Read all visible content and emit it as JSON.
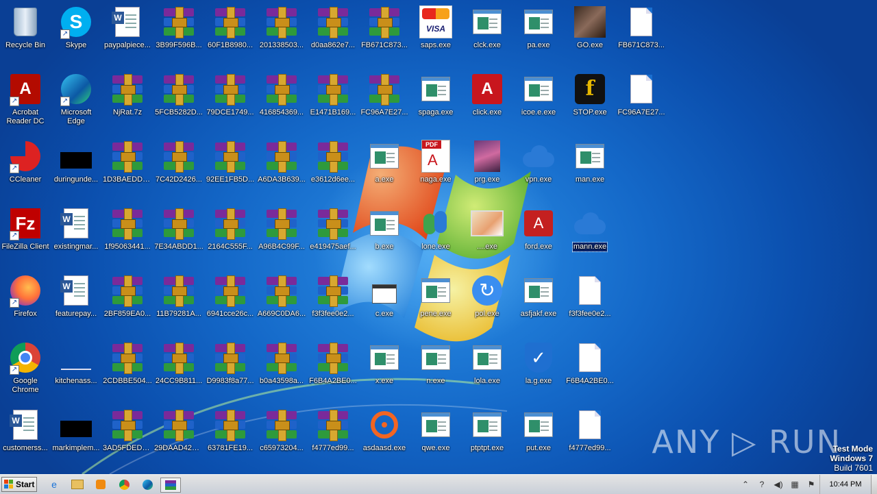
{
  "desktop": {
    "icons": [
      {
        "id": "recycle",
        "label": "Recycle Bin",
        "type": "recycle"
      },
      {
        "id": "skype",
        "label": "Skype",
        "type": "skype"
      },
      {
        "id": "paypal",
        "label": "paypalpiece...",
        "type": "word"
      },
      {
        "id": "a1",
        "label": "3B99F596B...",
        "type": "archive"
      },
      {
        "id": "a2",
        "label": "60F1B8980...",
        "type": "archive"
      },
      {
        "id": "a3",
        "label": "201338503...",
        "type": "archive"
      },
      {
        "id": "a4",
        "label": "d0aa862e7...",
        "type": "archive"
      },
      {
        "id": "a5",
        "label": "FB671C873...",
        "type": "archive"
      },
      {
        "id": "saps",
        "label": "saps.exe",
        "type": "card"
      },
      {
        "id": "clck",
        "label": "clck.exe",
        "type": "exe"
      },
      {
        "id": "pa",
        "label": "pa.exe",
        "type": "exe"
      },
      {
        "id": "go",
        "label": "GO.exe",
        "type": "photo"
      },
      {
        "id": "fb1",
        "label": "FB671C873...",
        "type": "blank"
      },
      {
        "id": "acrobat",
        "label": "Acrobat Reader DC",
        "type": "acrobat"
      },
      {
        "id": "edge",
        "label": "Microsoft Edge",
        "type": "edge"
      },
      {
        "id": "njrat",
        "label": "NjRat.7z",
        "type": "archive"
      },
      {
        "id": "b1",
        "label": "5FCB5282D...",
        "type": "archive"
      },
      {
        "id": "b2",
        "label": "79DCE1749...",
        "type": "archive"
      },
      {
        "id": "b3",
        "label": "416854369...",
        "type": "archive"
      },
      {
        "id": "b4",
        "label": "E1471B169...",
        "type": "archive"
      },
      {
        "id": "b5",
        "label": "FC96A7E27...",
        "type": "archive"
      },
      {
        "id": "spaga",
        "label": "spaga.exe",
        "type": "exe"
      },
      {
        "id": "click",
        "label": "click.exe",
        "type": "pdf"
      },
      {
        "id": "icoe",
        "label": "icoe.e.exe",
        "type": "exe"
      },
      {
        "id": "stop",
        "label": "STOP.exe",
        "type": "fb"
      },
      {
        "id": "fc1",
        "label": "FC96A7E27...",
        "type": "blank"
      },
      {
        "id": "ccleaner",
        "label": "CCleaner",
        "type": "ccleaner"
      },
      {
        "id": "during",
        "label": "duringunde...",
        "type": "black"
      },
      {
        "id": "c1",
        "label": "1D3BAEDD7...",
        "type": "archive"
      },
      {
        "id": "c2",
        "label": "7C42D2426...",
        "type": "archive"
      },
      {
        "id": "c3",
        "label": "92EE1FB5D...",
        "type": "archive"
      },
      {
        "id": "c4",
        "label": "A6DA3B639...",
        "type": "archive"
      },
      {
        "id": "c5",
        "label": "e3612d6ee...",
        "type": "archive"
      },
      {
        "id": "aexe",
        "label": "a.exe",
        "type": "exe"
      },
      {
        "id": "naga",
        "label": "naga.exe",
        "type": "pdfdoc"
      },
      {
        "id": "prg",
        "label": "prg.exe",
        "type": "photo2"
      },
      {
        "id": "vpn",
        "label": "vpn.exe",
        "type": "cloud"
      },
      {
        "id": "man",
        "label": "man.exe",
        "type": "exe"
      },
      {
        "id": "filezilla",
        "label": "FileZilla Client",
        "type": "filezilla"
      },
      {
        "id": "existing",
        "label": "existingmar...",
        "type": "word"
      },
      {
        "id": "d1",
        "label": "1f95063441...",
        "type": "archive"
      },
      {
        "id": "d2",
        "label": "7E34ABDD1...",
        "type": "archive"
      },
      {
        "id": "d3",
        "label": "2164C555F...",
        "type": "archive"
      },
      {
        "id": "d4",
        "label": "A96B4C99F...",
        "type": "archive"
      },
      {
        "id": "d5",
        "label": "e419475aef...",
        "type": "archive"
      },
      {
        "id": "bexe",
        "label": "b.exe",
        "type": "exe"
      },
      {
        "id": "lone",
        "label": "lone.exe",
        "type": "msn"
      },
      {
        "id": "img1",
        "label": "....exe",
        "type": "imgfile"
      },
      {
        "id": "ford",
        "label": "ford.exe",
        "type": "redbox"
      },
      {
        "id": "mann",
        "label": "mann.exe",
        "type": "cloud",
        "selected": true
      },
      {
        "id": "firefox",
        "label": "Firefox",
        "type": "firefox"
      },
      {
        "id": "featurepay",
        "label": "featurepay...",
        "type": "word"
      },
      {
        "id": "e1",
        "label": "2BF859EA0...",
        "type": "archive"
      },
      {
        "id": "e2",
        "label": "11B79281A...",
        "type": "archive"
      },
      {
        "id": "e3",
        "label": "6941cce26c...",
        "type": "archive"
      },
      {
        "id": "e4",
        "label": "A669C0DA6...",
        "type": "archive"
      },
      {
        "id": "e5",
        "label": "f3f3fee0e2...",
        "type": "archive"
      },
      {
        "id": "cexe",
        "label": "c.exe",
        "type": "folderwin"
      },
      {
        "id": "pene",
        "label": "pene.exe",
        "type": "exe"
      },
      {
        "id": "pol",
        "label": "pol.exe",
        "type": "gear"
      },
      {
        "id": "asf",
        "label": "asfjakf.exe",
        "type": "exe"
      },
      {
        "id": "f3b",
        "label": "f3f3fee0e2...",
        "type": "blank"
      },
      {
        "id": "chrome",
        "label": "Google Chrome",
        "type": "chrome"
      },
      {
        "id": "kitchen",
        "label": "kitchenass...",
        "type": "kitchen"
      },
      {
        "id": "f1",
        "label": "2CDBBE504...",
        "type": "archive"
      },
      {
        "id": "f2",
        "label": "24CC9B811...",
        "type": "archive"
      },
      {
        "id": "f3",
        "label": "D9983f8a77...",
        "type": "archive"
      },
      {
        "id": "f4",
        "label": "b0a43598a...",
        "type": "archive"
      },
      {
        "id": "f5",
        "label": "F6B4A2BE0...",
        "type": "archive"
      },
      {
        "id": "xexe",
        "label": "x.exe",
        "type": "exe"
      },
      {
        "id": "nexe",
        "label": "n.exe",
        "type": "exe"
      },
      {
        "id": "lola",
        "label": "lola.exe",
        "type": "exe"
      },
      {
        "id": "lag",
        "label": "la.g.exe",
        "type": "shield"
      },
      {
        "id": "f6b",
        "label": "F6B4A2BE0...",
        "type": "blank"
      },
      {
        "id": "customer",
        "label": "customerss...",
        "type": "word"
      },
      {
        "id": "markimp",
        "label": "markimplem...",
        "type": "black"
      },
      {
        "id": "g1",
        "label": "3AD5FDED9...",
        "type": "archive"
      },
      {
        "id": "g2",
        "label": "29DAAD42D...",
        "type": "archive"
      },
      {
        "id": "g3",
        "label": "63781FE19...",
        "type": "archive"
      },
      {
        "id": "g4",
        "label": "c65973204...",
        "type": "archive"
      },
      {
        "id": "g5",
        "label": "f4777ed99...",
        "type": "archive"
      },
      {
        "id": "asdaasd",
        "label": "asdaasd.exe",
        "type": "origin"
      },
      {
        "id": "qwe",
        "label": "qwe.exe",
        "type": "exe"
      },
      {
        "id": "ptptpt",
        "label": "ptptpt.exe",
        "type": "exe"
      },
      {
        "id": "put",
        "label": "put.exe",
        "type": "exe"
      },
      {
        "id": "f47b",
        "label": "f4777ed99...",
        "type": "blank"
      }
    ]
  },
  "watermark": {
    "text": "ANY ▷ RUN"
  },
  "testmode": {
    "line1": "Test Mode",
    "line2": "Windows 7",
    "line3": "Build 7601"
  },
  "taskbar": {
    "start_label": "Start",
    "clock": "10:44 PM",
    "pinned": [
      "ie-icon",
      "explorer-icon",
      "media-player-icon",
      "chrome-icon",
      "edge-icon",
      "winrar-icon"
    ],
    "tray": [
      "show-hidden-icon",
      "help-icon",
      "volume-icon",
      "network-icon",
      "flag-icon"
    ]
  }
}
